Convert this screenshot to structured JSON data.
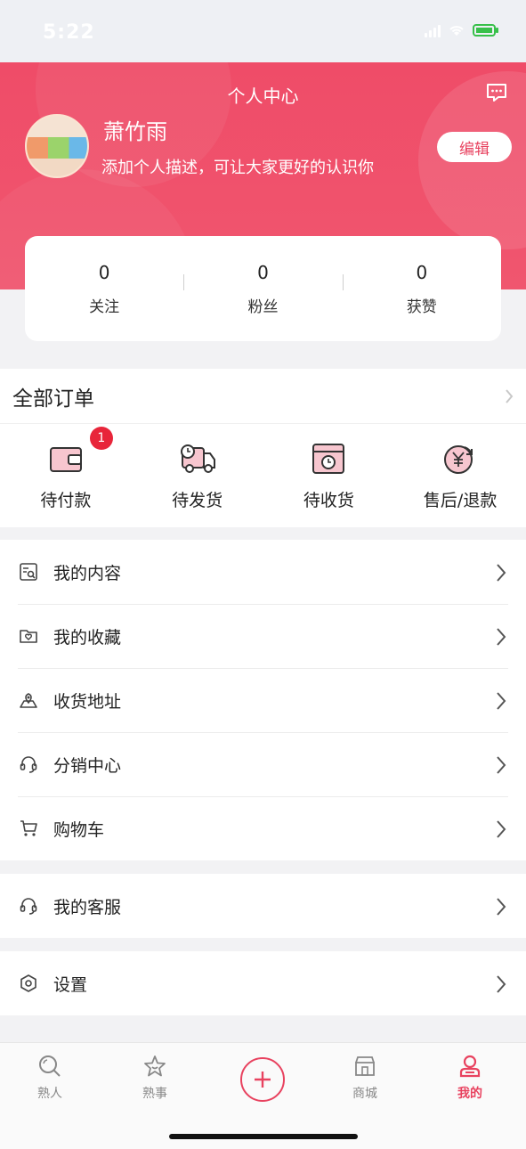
{
  "status_bar": {
    "time": "5:22"
  },
  "header": {
    "title": "个人中心",
    "user_name": "萧竹雨",
    "user_desc": "添加个人描述，可让大家更好的认识你",
    "edit_label": "编辑"
  },
  "stats": [
    {
      "value": "0",
      "label": "关注"
    },
    {
      "value": "0",
      "label": "粉丝"
    },
    {
      "value": "0",
      "label": "获赞"
    }
  ],
  "orders": {
    "title": "全部订单",
    "items": [
      {
        "label": "待付款",
        "icon": "wallet-icon",
        "badge": "1"
      },
      {
        "label": "待发货",
        "icon": "delivery-truck-icon"
      },
      {
        "label": "待收货",
        "icon": "package-clock-icon"
      },
      {
        "label": "售后/退款",
        "icon": "yen-refund-icon"
      }
    ]
  },
  "menu_main": [
    {
      "label": "我的内容",
      "icon": "document-search-icon"
    },
    {
      "label": "我的收藏",
      "icon": "folder-heart-icon"
    },
    {
      "label": "收货地址",
      "icon": "map-location-icon"
    },
    {
      "label": "分销中心",
      "icon": "headset-icon"
    },
    {
      "label": "购物车",
      "icon": "shopping-cart-icon"
    }
  ],
  "menu_service": [
    {
      "label": "我的客服",
      "icon": "headset-icon"
    }
  ],
  "menu_settings": [
    {
      "label": "设置",
      "icon": "settings-icon"
    }
  ],
  "tabbar": [
    {
      "label": "熟人",
      "icon": "search-icon",
      "active": false
    },
    {
      "label": "熟事",
      "icon": "star-icon",
      "active": false
    },
    {
      "label": "",
      "icon": "plus-icon",
      "active": false
    },
    {
      "label": "商城",
      "icon": "store-icon",
      "active": false
    },
    {
      "label": "我的",
      "icon": "user-icon",
      "active": true
    }
  ],
  "colors": {
    "accent": "#e8425f",
    "header_bg": "#ef4c68",
    "badge": "#e8253a"
  }
}
